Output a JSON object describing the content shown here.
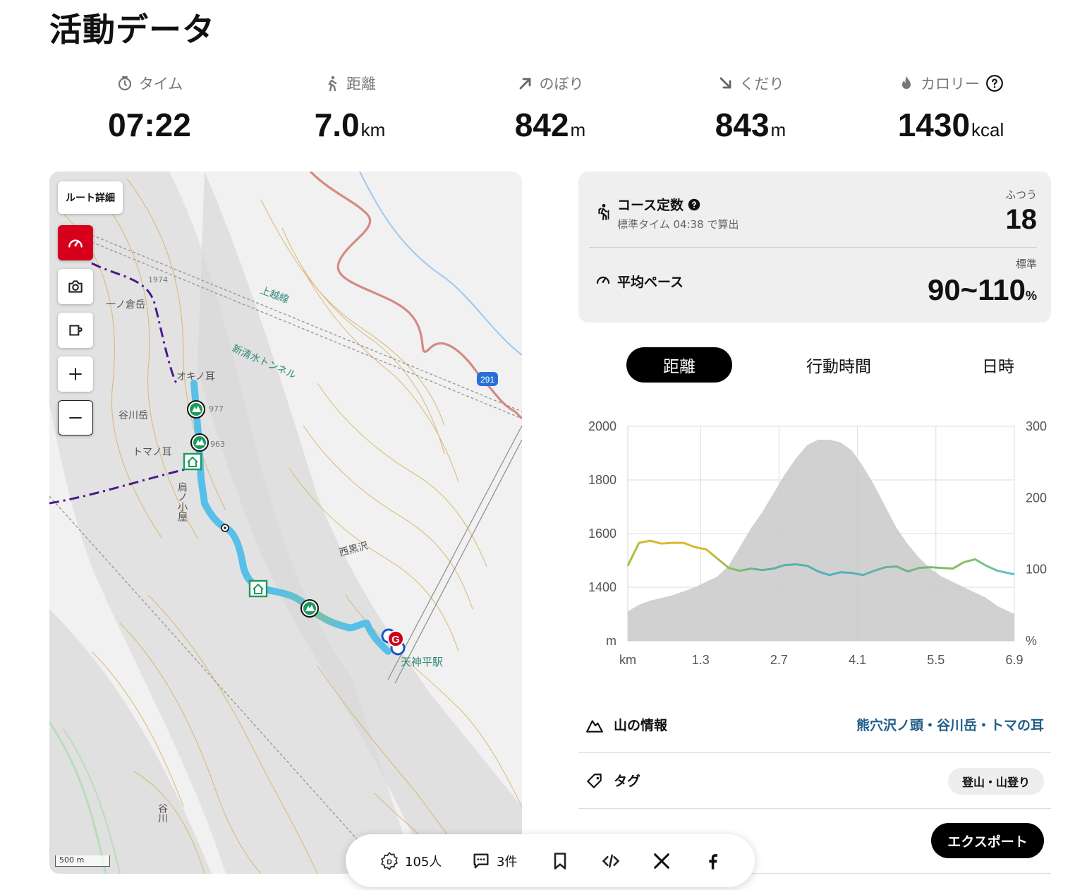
{
  "page_title": "活動データ",
  "stats": [
    {
      "label": "タイム",
      "value": "07:22",
      "unit": "",
      "icon": "stopwatch-icon"
    },
    {
      "label": "距離",
      "value": "7.0",
      "unit": "km",
      "icon": "walking-icon"
    },
    {
      "label": "のぼり",
      "value": "842",
      "unit": "m",
      "icon": "arrow-up-right-icon"
    },
    {
      "label": "くだり",
      "value": "843",
      "unit": "m",
      "icon": "arrow-down-right-icon"
    },
    {
      "label": "カロリー",
      "value": "1430",
      "unit": "kcal",
      "icon": "flame-icon"
    }
  ],
  "map": {
    "route_detail_label": "ルート詳細",
    "scale_label": "500 m",
    "place_labels": [
      "一ノ倉岳",
      "オキノ耳",
      "谷川岳",
      "トマノ耳",
      "肩ノ小屋",
      "上越線",
      "新清水トンネル",
      "西黒沢",
      "天神平駅",
      "谷川",
      "1974",
      "977",
      "963",
      "291"
    ],
    "goal_marker": "G"
  },
  "course": {
    "title": "コース定数",
    "subtitle": "標準タイム 04:38 で算出",
    "level": "ふつう",
    "value": "18"
  },
  "pace": {
    "title": "平均ペース",
    "level": "標準",
    "value": "90~110",
    "unit": "%"
  },
  "tabs": [
    {
      "label": "距離",
      "active": true
    },
    {
      "label": "行動時間",
      "active": false
    },
    {
      "label": "日時",
      "active": false
    }
  ],
  "chart_data": {
    "type": "area",
    "x_ticks": [
      "km",
      "1.3",
      "2.7",
      "4.1",
      "5.5",
      "6.9"
    ],
    "y_left_ticks": [
      "2000",
      "1800",
      "1600",
      "1400",
      "m"
    ],
    "y_right_ticks": [
      "300",
      "200",
      "100",
      "%"
    ],
    "ylim_left": [
      1200,
      2000
    ],
    "ylim_right": [
      0,
      300
    ],
    "xlim": [
      0,
      6.9
    ],
    "grid": true,
    "series": [
      {
        "kind": "elevation",
        "color": "#c9c9c9",
        "x": [
          0,
          0.2,
          0.4,
          0.6,
          0.8,
          1.0,
          1.2,
          1.4,
          1.6,
          1.8,
          2.0,
          2.2,
          2.4,
          2.6,
          2.8,
          3.0,
          3.2,
          3.4,
          3.6,
          3.8,
          4.0,
          4.2,
          4.4,
          4.6,
          4.8,
          5.0,
          5.2,
          5.4,
          5.6,
          5.8,
          6.0,
          6.2,
          6.4,
          6.6,
          6.9
        ],
        "y": [
          1310,
          1335,
          1350,
          1360,
          1370,
          1385,
          1400,
          1420,
          1440,
          1480,
          1550,
          1620,
          1680,
          1750,
          1820,
          1880,
          1930,
          1950,
          1950,
          1940,
          1910,
          1850,
          1780,
          1700,
          1620,
          1560,
          1510,
          1470,
          1440,
          1420,
          1400,
          1380,
          1360,
          1330,
          1300
        ]
      },
      {
        "kind": "pace",
        "x": [
          0,
          0.2,
          0.4,
          0.6,
          0.8,
          1.0,
          1.2,
          1.4,
          1.6,
          1.8,
          2.0,
          2.2,
          2.4,
          2.6,
          2.8,
          3.0,
          3.2,
          3.4,
          3.6,
          3.8,
          4.0,
          4.2,
          4.4,
          4.6,
          4.8,
          5.0,
          5.2,
          5.4,
          5.6,
          5.8,
          6.0,
          6.2,
          6.4,
          6.6,
          6.9
        ],
        "y": [
          105,
          137,
          140,
          136,
          137,
          137,
          131,
          128,
          115,
          102,
          98,
          101,
          99,
          101,
          106,
          107,
          105,
          97,
          92,
          96,
          95,
          92,
          98,
          103,
          104,
          97,
          102,
          103,
          102,
          101,
          110,
          114,
          105,
          98,
          93
        ]
      }
    ]
  },
  "info": {
    "mountain_label": "山の情報",
    "mountain_value": "熊穴沢ノ頭・谷川岳・トマの耳",
    "tag_label": "タグ",
    "tag_value": "登山・山登り",
    "export_label": "エクスポート"
  },
  "share": {
    "likes": "105人",
    "comments": "3件"
  }
}
